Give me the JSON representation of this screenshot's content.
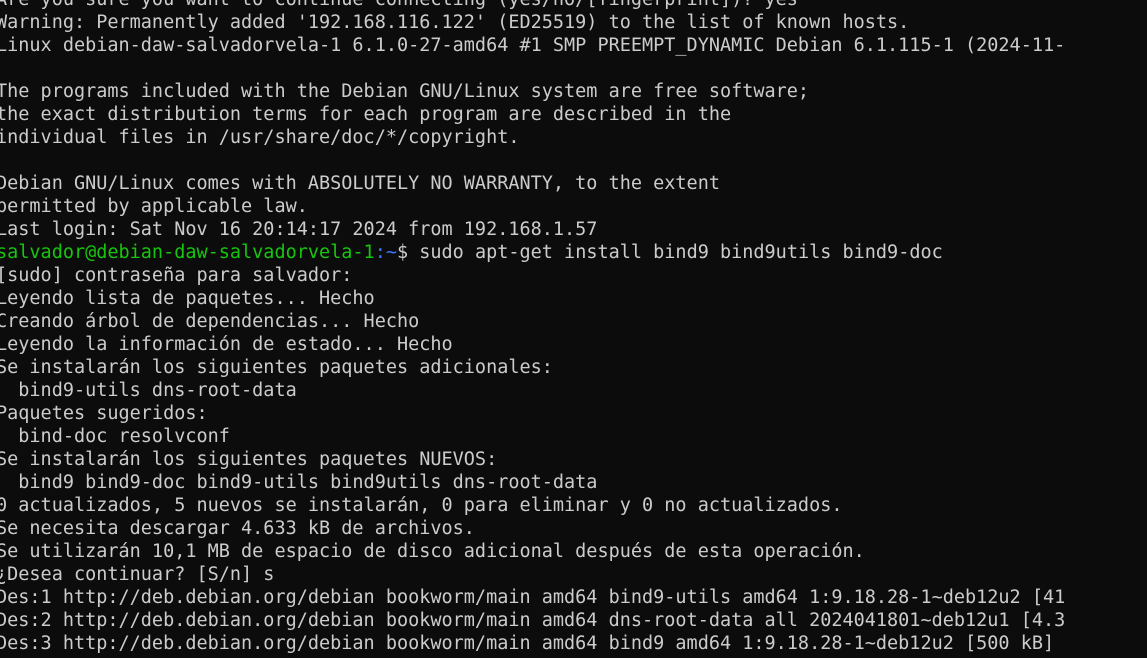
{
  "terminal": {
    "colors": {
      "background": "#0c0c0c",
      "foreground": "#cccccc",
      "prompt_user": "#16c60c",
      "prompt_path": "#3b78ff"
    },
    "before_prompt": [
      "Are you sure you want to continue connecting (yes/no/[fingerprint])? yes",
      "Warning: Permanently added '192.168.116.122' (ED25519) to the list of known hosts.",
      "Linux debian-daw-salvadorvela-1 6.1.0-27-amd64 #1 SMP PREEMPT_DYNAMIC Debian 6.1.115-1 (2024-11-",
      "",
      "The programs included with the Debian GNU/Linux system are free software;",
      "the exact distribution terms for each program are described in the",
      "individual files in /usr/share/doc/*/copyright.",
      "",
      "Debian GNU/Linux comes with ABSOLUTELY NO WARRANTY, to the extent",
      "permitted by applicable law.",
      "Last login: Sat Nov 16 20:14:17 2024 from 192.168.1.57"
    ],
    "prompt": {
      "user_host": "salvador@debian-daw-salvadorvela-1",
      "colon": ":",
      "path": "~",
      "symbol": "$",
      "command": " sudo apt-get install bind9 bind9utils bind9-doc"
    },
    "after_prompt": [
      "[sudo] contraseña para salvador:",
      "Leyendo lista de paquetes... Hecho",
      "Creando árbol de dependencias... Hecho",
      "Leyendo la información de estado... Hecho",
      "Se instalarán los siguientes paquetes adicionales:",
      "  bind9-utils dns-root-data",
      "Paquetes sugeridos:",
      "  bind-doc resolvconf",
      "Se instalarán los siguientes paquetes NUEVOS:",
      "  bind9 bind9-doc bind9-utils bind9utils dns-root-data",
      "0 actualizados, 5 nuevos se instalarán, 0 para eliminar y 0 no actualizados.",
      "Se necesita descargar 4.633 kB de archivos.",
      "Se utilizarán 10,1 MB de espacio de disco adicional después de esta operación.",
      "¿Desea continuar? [S/n] s",
      "Des:1 http://deb.debian.org/debian bookworm/main amd64 bind9-utils amd64 1:9.18.28-1~deb12u2 [41",
      "Des:2 http://deb.debian.org/debian bookworm/main amd64 dns-root-data all 2024041801~deb12u1 [4.3",
      "Des:3 http://deb.debian.org/debian bookworm/main amd64 bind9 amd64 1:9.18.28-1~deb12u2 [500 kB]"
    ]
  }
}
